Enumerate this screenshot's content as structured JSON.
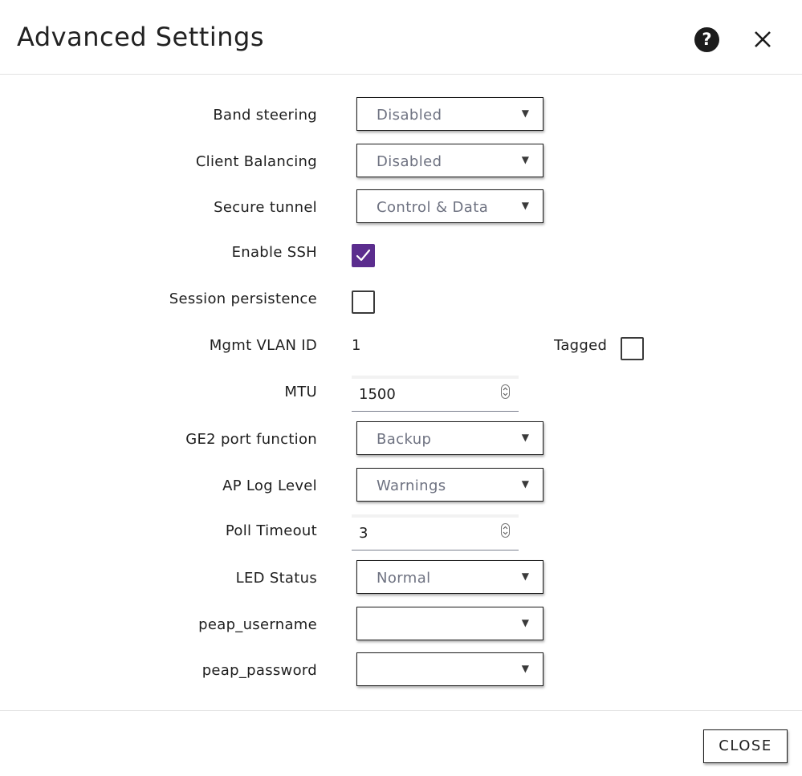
{
  "dialog": {
    "title": "Advanced Settings",
    "help_icon": "question-circle-icon",
    "close_icon": "close-x-icon"
  },
  "fields": {
    "band_steering": {
      "label": "Band steering",
      "value": "Disabled"
    },
    "client_balancing": {
      "label": "Client Balancing",
      "value": "Disabled"
    },
    "secure_tunnel": {
      "label": "Secure tunnel",
      "value": "Control & Data"
    },
    "enable_ssh": {
      "label": "Enable SSH",
      "checked": true
    },
    "session_persistence": {
      "label": "Session persistence",
      "checked": false
    },
    "mgmt_vlan_id": {
      "label": "Mgmt VLAN ID",
      "value": "1",
      "tagged_label": "Tagged",
      "tagged_checked": false
    },
    "mtu": {
      "label": "MTU",
      "value": "1500"
    },
    "ge2_port_function": {
      "label": "GE2 port function",
      "value": "Backup"
    },
    "ap_log_level": {
      "label": "AP Log Level",
      "value": "Warnings"
    },
    "poll_timeout": {
      "label": "Poll Timeout",
      "value": "3"
    },
    "led_status": {
      "label": "LED Status",
      "value": "Normal"
    },
    "peap_username": {
      "label": "peap_username",
      "value": ""
    },
    "peap_password": {
      "label": "peap_password",
      "value": ""
    }
  },
  "footer": {
    "close_label": "CLOSE"
  },
  "colors": {
    "checkbox_checked": "#5b2d8e",
    "select_value_text": "#6e7281"
  }
}
